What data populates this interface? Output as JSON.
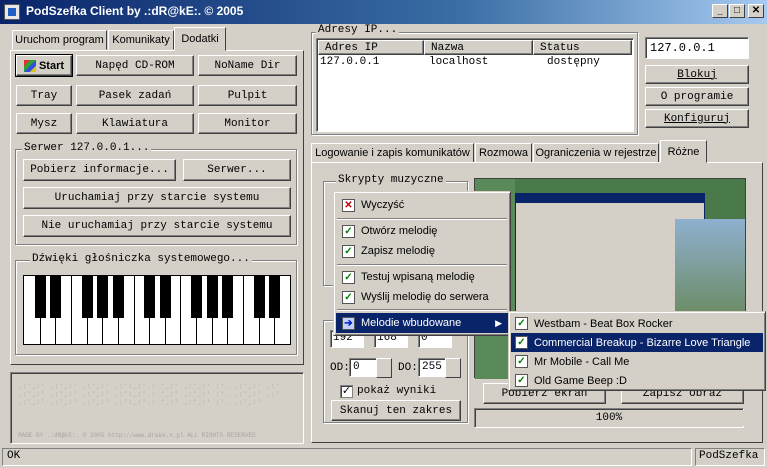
{
  "window": {
    "title": "PodSzefka Client by .:dR@kE:. © 2005"
  },
  "left_tabs": [
    "Uruchom program",
    "Komunikaty",
    "Dodatki"
  ],
  "left_buttons": {
    "start": "Start",
    "cdrom": "Napęd CD-ROM",
    "noname": "NoName Dir",
    "tray": "Tray",
    "taskbar": "Pasek zadań",
    "desktop": "Pulpit",
    "mouse": "Mysz",
    "keyboard": "Klawiatura",
    "monitor": "Monitor"
  },
  "server_group": {
    "legend": "Serwer 127.0.0.1...",
    "fetch_info": "Pobierz informacje...",
    "server": "Serwer...",
    "autostart": "Uruchamiaj przy starcie systemu",
    "no_autostart": "Nie uruchamiaj przy starcie systemu"
  },
  "speaker_group": {
    "legend": "Dźwięki głośniczka systemowego..."
  },
  "footer_note": "MADE BY .:dR@kE:. © 2005 http://www.drake.x.pl ALL RIGHTS RESERVED",
  "ip_group": {
    "legend": "Adresy IP...",
    "columns": [
      "Adres IP",
      "Nazwa",
      "Status"
    ],
    "rows": [
      {
        "ip": "127.0.0.1",
        "name": "localhost",
        "status": "dostępny"
      }
    ]
  },
  "right_panel": {
    "ip_field": "127.0.0.1",
    "block": "Blokuj",
    "about": "O programie",
    "configure": "Konfiguruj"
  },
  "right_tabs": [
    "Logowanie i zapis komunikatów",
    "Rozmowa",
    "Ograniczenia w rejestrze",
    "Różne"
  ],
  "music_group": {
    "legend": "Skrypty muzyczne"
  },
  "scan": {
    "od_label": "OD:",
    "od_value": "0",
    "do_label": "DO:",
    "do_value": "255",
    "ip_part1": "192",
    "ip_part2": "168",
    "ip_part3": "0",
    "show_results": "pokaż wyniki",
    "scan_button": "Skanuj ten zakres"
  },
  "screenshot": {
    "fetch": "Pobierz ekran",
    "save": "Zapisz obraz",
    "progress_text": "100%",
    "progress": 1.0
  },
  "context_menu": {
    "items": [
      {
        "label": "Wyczyść",
        "icon": "x-icon"
      },
      {
        "label": "Otwórz melodię",
        "icon": "check-icon"
      },
      {
        "label": "Zapisz melodię",
        "icon": "check-icon"
      },
      {
        "label": "Testuj wpisaną melodię",
        "icon": "check-icon"
      },
      {
        "label": "Wyślij melodię do serwera",
        "icon": "check-icon"
      },
      {
        "label": "Melodie wbudowane",
        "icon": "arrow-icon"
      }
    ]
  },
  "submenu": {
    "items": [
      "Westbam - Beat Box Rocker",
      "Commercial Breakup - Bizarre Love Triangle",
      "Mr Mobile - Call Me",
      "Old Game Beep :D"
    ],
    "selected_index": 1
  },
  "statusbar": {
    "left": "OK",
    "right": "PodSzefka"
  },
  "colors": {
    "titlebar": "#0a246a",
    "selection": "#0a246a",
    "face": "#d4d0c8"
  }
}
